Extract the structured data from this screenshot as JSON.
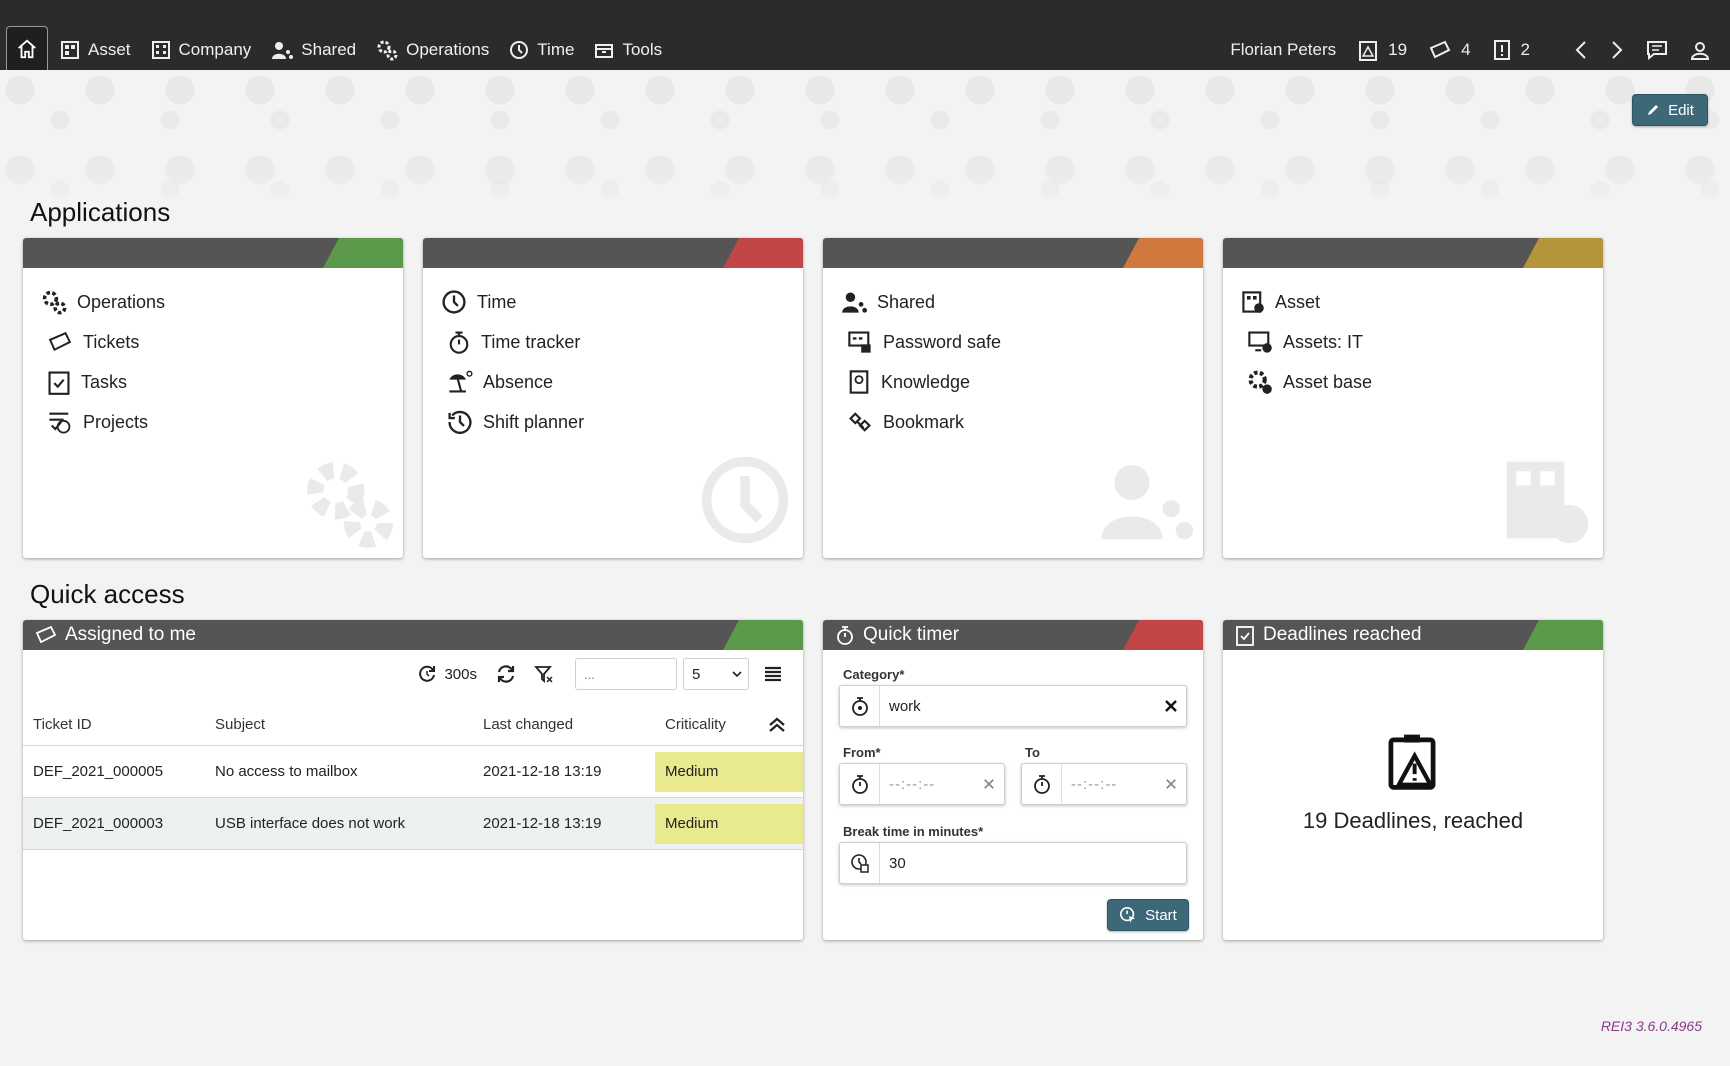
{
  "topnav": {
    "items": [
      {
        "label": "Asset",
        "icon": "asset-grid-icon"
      },
      {
        "label": "Company",
        "icon": "building-icon"
      },
      {
        "label": "Shared",
        "icon": "shared-user-icon"
      },
      {
        "label": "Operations",
        "icon": "gears-icon"
      },
      {
        "label": "Time",
        "icon": "clock-icon"
      },
      {
        "label": "Tools",
        "icon": "toolbox-icon"
      }
    ],
    "user_name": "Florian Peters",
    "deadlines_count": "19",
    "tickets_count": "4",
    "tasks_count": "2"
  },
  "edit_label": "Edit",
  "applications": {
    "title": "Applications",
    "cards": [
      {
        "accent": "#5a9a4a",
        "items": [
          {
            "label": "Operations"
          },
          {
            "label": "Tickets"
          },
          {
            "label": "Tasks"
          },
          {
            "label": "Projects"
          }
        ]
      },
      {
        "accent": "#c24646",
        "items": [
          {
            "label": "Time"
          },
          {
            "label": "Time tracker"
          },
          {
            "label": "Absence"
          },
          {
            "label": "Shift planner"
          }
        ]
      },
      {
        "accent": "#d0783e",
        "items": [
          {
            "label": "Shared"
          },
          {
            "label": "Password safe"
          },
          {
            "label": "Knowledge"
          },
          {
            "label": "Bookmark"
          }
        ]
      },
      {
        "accent": "#b5943a",
        "items": [
          {
            "label": "Asset"
          },
          {
            "label": "Assets: IT"
          },
          {
            "label": "Asset base"
          }
        ]
      }
    ]
  },
  "quick_access": {
    "title": "Quick access",
    "assigned": {
      "title": "Assigned to me",
      "accent": "#5a9a4a",
      "refresh_label": "300s",
      "search_placeholder": "...",
      "page_size": "5",
      "columns": [
        "Ticket ID",
        "Subject",
        "Last changed",
        "Criticality"
      ],
      "rows": [
        {
          "id": "DEF_2021_000005",
          "subject": "No access to mailbox",
          "changed": "2021-12-18 13:19",
          "criticality": "Medium"
        },
        {
          "id": "DEF_2021_000003",
          "subject": "USB interface does not work",
          "changed": "2021-12-18 13:19",
          "criticality": "Medium"
        }
      ]
    },
    "timer": {
      "title": "Quick timer",
      "accent": "#c24646",
      "category_label": "Category*",
      "category_value": "work",
      "from_label": "From*",
      "to_label": "To",
      "time_placeholder": "--:--:--",
      "break_label": "Break time in minutes*",
      "break_value": "30",
      "start_label": "Start"
    },
    "deadlines": {
      "title": "Deadlines reached",
      "accent": "#5a9a4a",
      "text": "19 Deadlines, reached"
    }
  },
  "version": "REI3 3.6.0.4965",
  "colors": {
    "topbar": "#2b2b2b",
    "card_header": "#555555",
    "button": "#3d6878",
    "criticality_medium": "#e9e98f"
  }
}
